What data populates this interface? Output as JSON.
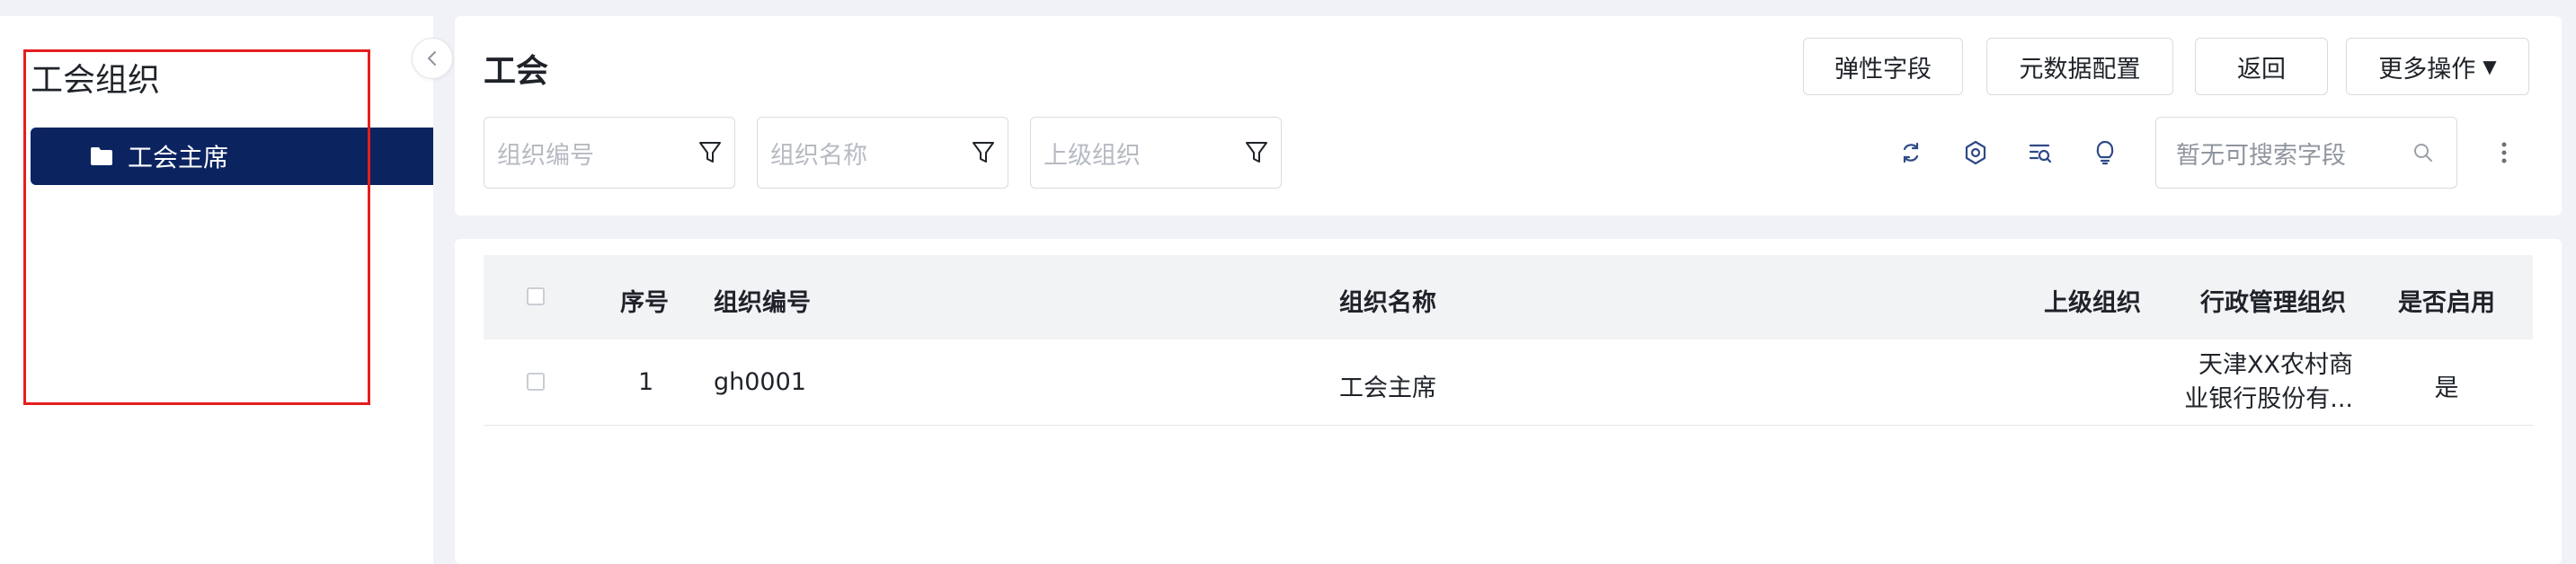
{
  "sidebar": {
    "title": "工会组织",
    "tree_nodes": [
      {
        "label": "工会主席",
        "selected": true
      }
    ]
  },
  "header": {
    "title": "工会",
    "buttons": {
      "flex_fields": "弹性字段",
      "metadata_config": "元数据配置",
      "back": "返回",
      "more_actions": "更多操作"
    }
  },
  "filters": [
    {
      "placeholder": "组织编号"
    },
    {
      "placeholder": "组织名称"
    },
    {
      "placeholder": "上级组织"
    }
  ],
  "search": {
    "placeholder": "暂无可搜索字段"
  },
  "toolbar_icons": [
    "refresh-icon",
    "settings-icon",
    "search-list-icon",
    "lightbulb-icon",
    "more-vertical-icon"
  ],
  "table": {
    "columns": [
      "序号",
      "组织编号",
      "组织名称",
      "上级组织",
      "行政管理组织",
      "是否启用"
    ],
    "rows": [
      {
        "index": "1",
        "code": "gh0001",
        "name": "工会主席",
        "parent": "",
        "admin_org_line1": "天津XX农村商",
        "admin_org_line2": "业银行股份有...",
        "enabled": "是"
      }
    ]
  },
  "colors": {
    "accent": "#0b2460",
    "highlight_border": "#e51e1e",
    "page_bg": "#f0f2f7",
    "icon_blue": "#2e4a86"
  }
}
